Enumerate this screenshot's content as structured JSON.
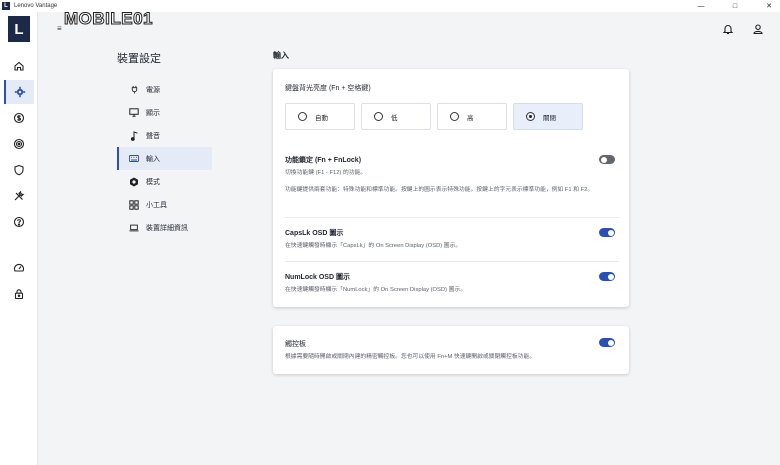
{
  "window": {
    "title": "Lenovo Vantage",
    "logo_letter": "L"
  },
  "watermark": {
    "text": "MOBILE01"
  },
  "rail": {
    "logo_letter": "L"
  },
  "settings": {
    "title": "裝置設定",
    "menu": [
      {
        "label": "電源",
        "icon": "plug-icon"
      },
      {
        "label": "顯示",
        "icon": "monitor-icon"
      },
      {
        "label": "聲音",
        "icon": "music-note-icon"
      },
      {
        "label": "輸入",
        "icon": "keyboard-icon",
        "active": true
      },
      {
        "label": "模式",
        "icon": "hexagon-mode-icon"
      },
      {
        "label": "小工具",
        "icon": "widgets-icon"
      },
      {
        "label": "裝置詳細資訊",
        "icon": "laptop-icon"
      }
    ]
  },
  "input": {
    "section_title": "輸入",
    "backlight": {
      "label": "鍵盤背光亮度 (Fn + 空格鍵)",
      "options": [
        "自動",
        "低",
        "高",
        "關閉"
      ],
      "selected": "關閉"
    },
    "fnlock": {
      "title": "功能鎖定 (Fn + FnLock)",
      "desc1": "切換功能鍵 (F1 - F12) 的功能。",
      "desc2": "功能鍵提供兩套功能：特殊功能和標準功能。按鍵上的圖示表示特殊功能，按鍵上的字元表示標準功能，例如 F1 和 F2。",
      "enabled": false
    },
    "capslk": {
      "title": "CapsLk OSD 圖示",
      "desc": "在快速鍵觸發時顯示「CapsLk」的 On Screen Display (OSD) 圖示。",
      "enabled": true
    },
    "numlock": {
      "title": "NumLock OSD 圖示",
      "desc": "在快速鍵觸發時顯示「NumLock」的 On Screen Display (OSD) 圖示。",
      "enabled": true
    }
  },
  "touchpad": {
    "title": "觸控板",
    "desc": "根據需要隨時開啟或關閉內建的精密觸控板。您也可以使用 Fn+M 快速鍵開啟或關閉觸控板功能。",
    "enabled": true
  },
  "colors": {
    "accent": "#2a50b8",
    "brand": "#1c2a4a",
    "toggle_off": "#63666d"
  }
}
